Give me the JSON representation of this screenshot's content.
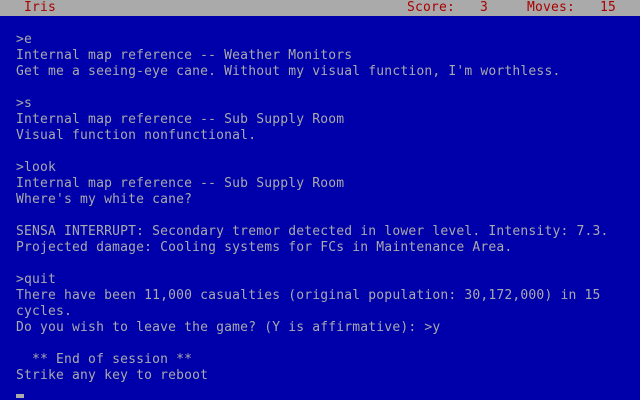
{
  "status_bar": {
    "story_name": "Iris",
    "score_label": "Score:",
    "score_value": "3",
    "moves_label": "Moves:",
    "moves_value": "15"
  },
  "transcript": {
    "lines": [
      ">e",
      "Internal map reference -- Weather Monitors",
      "Get me a seeing-eye cane. Without my visual function, I'm worthless.",
      "",
      ">s",
      "Internal map reference -- Sub Supply Room",
      "Visual function nonfunctional.",
      "",
      ">look",
      "Internal map reference -- Sub Supply Room",
      "Where's my white cane?",
      "",
      "SENSA INTERRUPT: Secondary tremor detected in lower level. Intensity: 7.3.",
      "Projected damage: Cooling systems for FCs in Maintenance Area.",
      "",
      ">quit",
      "There have been 11,000 casualties (original population: 30,172,000) in 15",
      "cycles.",
      "Do you wish to leave the game? (Y is affirmative): >y",
      "",
      "  ** End of session **",
      "Strike any key to reboot"
    ]
  },
  "colors": {
    "background": "#0000aa",
    "text": "#aaaaaa",
    "status_bar_background": "#aaaaaa",
    "status_bar_text": "#aa0000"
  }
}
